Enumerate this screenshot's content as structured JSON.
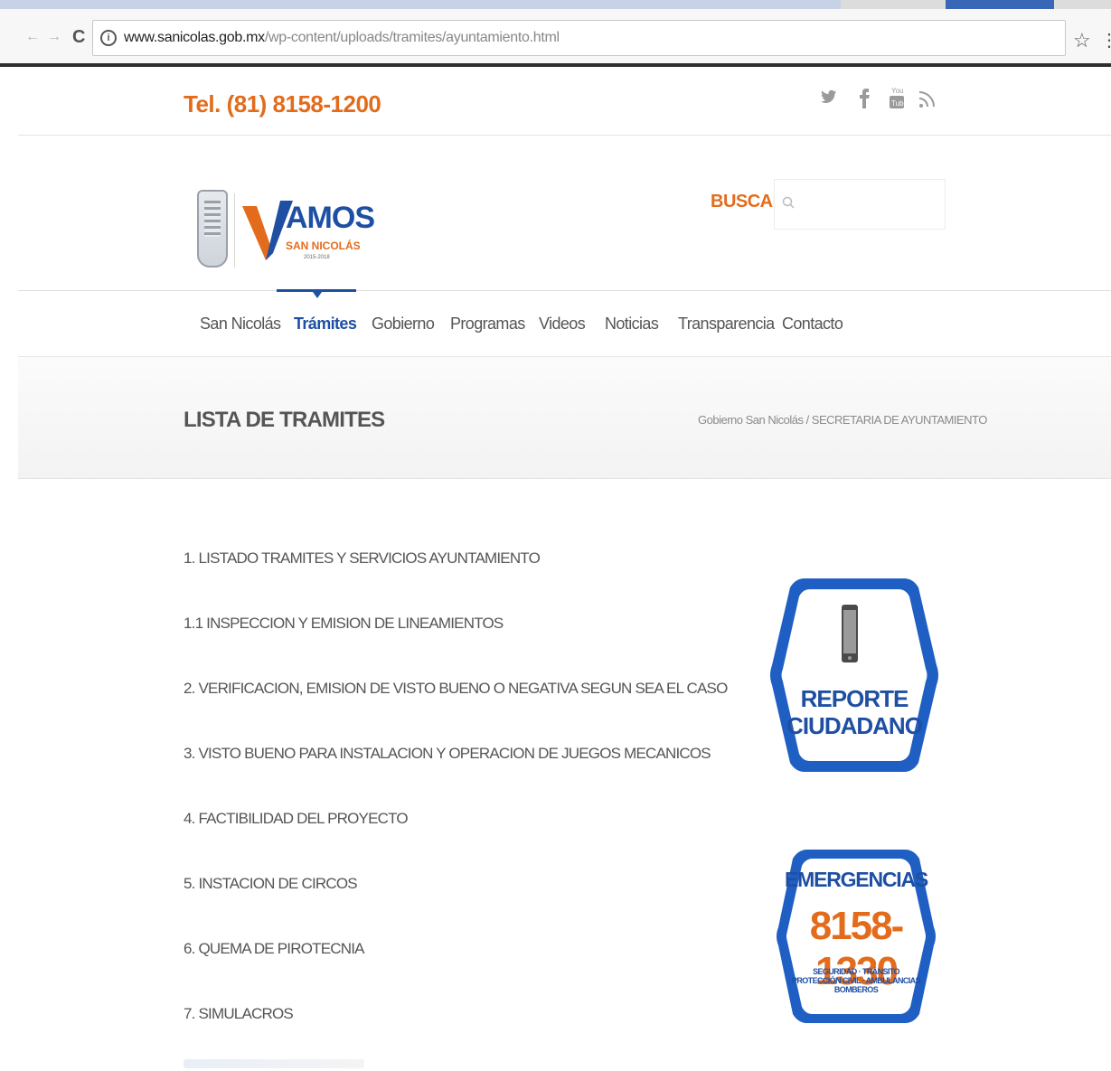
{
  "browser": {
    "url_host": "www.sanicolas.gob.mx",
    "url_path": "/wp-content/uploads/tramites/ayuntamiento.html",
    "icons": [
      "back-icon",
      "forward-icon",
      "reload-icon",
      "info-icon",
      "star-icon",
      "menu-icon"
    ]
  },
  "header": {
    "phone": "Tel. (81) 8158-1200",
    "social_icons": [
      "twitter-icon",
      "facebook-icon",
      "youtube-icon",
      "rss-icon"
    ]
  },
  "logo": {
    "word": "AMOS",
    "sub": "SAN NICOLÁS",
    "years": "2015-2018"
  },
  "search": {
    "label": "BUSCAR",
    "placeholder": ""
  },
  "nav": {
    "items": [
      {
        "label": "San Nicolás"
      },
      {
        "label": "Trámites"
      },
      {
        "label": "Gobierno"
      },
      {
        "label": "Programas"
      },
      {
        "label": "Videos"
      },
      {
        "label": "Noticias"
      },
      {
        "label": "Transparencia"
      },
      {
        "label": "Contacto"
      }
    ],
    "active": "Trámites"
  },
  "page": {
    "title": "LISTA DE TRAMITES",
    "breadcrumb": "Gobierno San Nicolás / SECRETARIA DE AYUNTAMIENTO"
  },
  "tramites": [
    "1. LISTADO TRAMITES Y SERVICIOS AYUNTAMIENTO",
    "1.1 INSPECCION Y EMISION DE LINEAMIENTOS",
    "2. VERIFICACION, EMISION DE VISTO BUENO O NEGATIVA SEGUN SEA EL CASO",
    "3. VISTO BUENO PARA INSTALACION Y OPERACION DE JUEGOS MECANICOS",
    "4. FACTIBILIDAD DEL PROYECTO",
    "5. INSTACION DE CIRCOS",
    "6. QUEMA DE PIROTECNIA",
    "7. SIMULACROS"
  ],
  "badges": {
    "reporte": {
      "line1": "REPORTE",
      "line2": "CIUDADANO"
    },
    "emergencias": {
      "title": "EMERGENCIAS",
      "number": "8158-1330",
      "line1": "SEGURIDAD · TRÁNSITO",
      "line2": "PROTECCIÓN CIVIL · AMBULANCIAS",
      "line3": "BOMBEROS"
    }
  },
  "colors": {
    "accent_orange": "#e36c1c",
    "brand_blue": "#1e4fa3"
  }
}
